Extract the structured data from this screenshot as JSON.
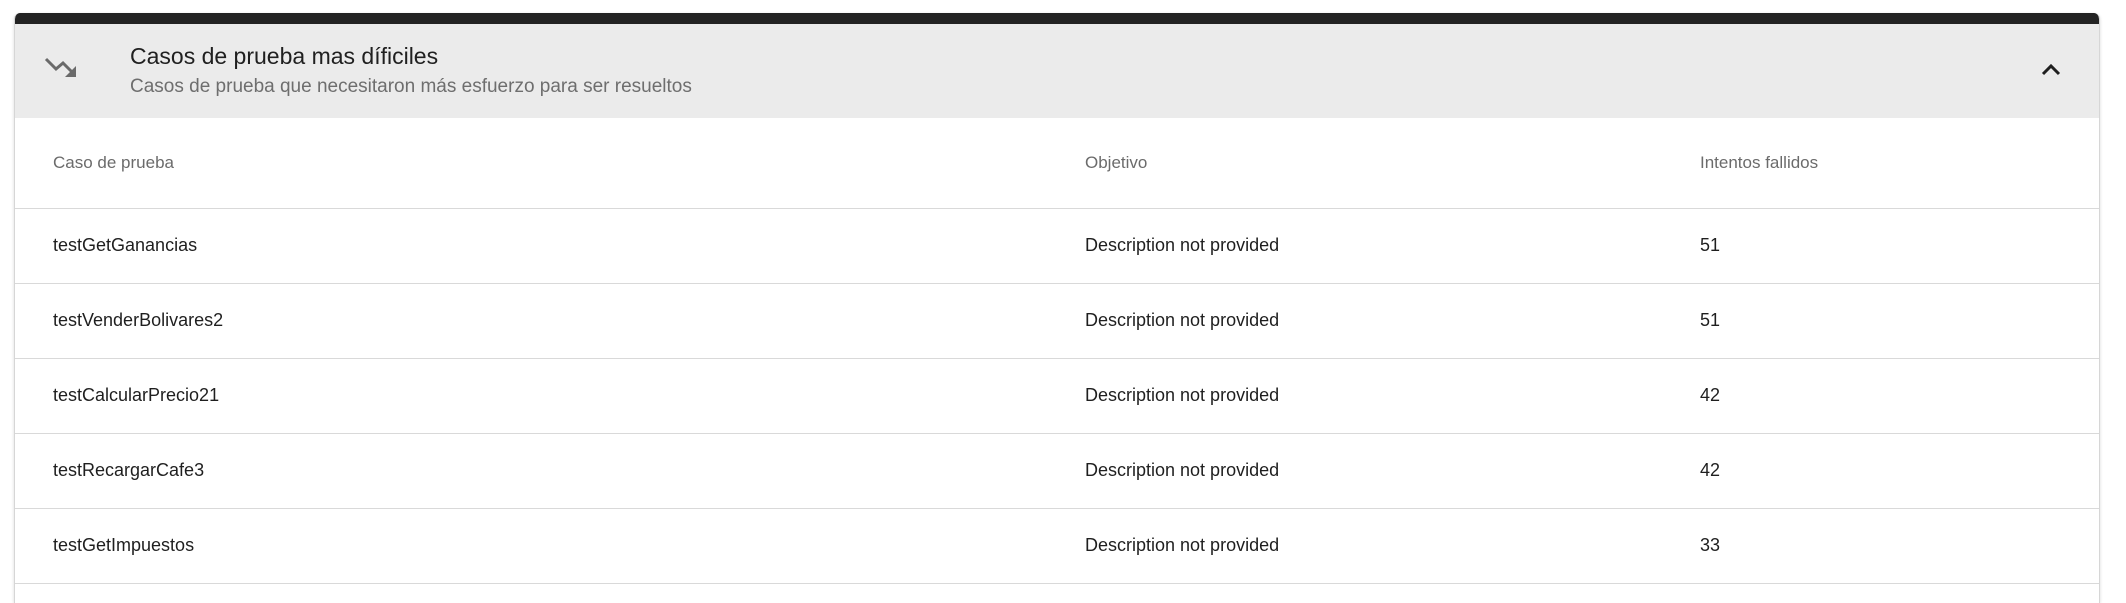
{
  "header": {
    "icon": "trending-down-icon",
    "title": "Casos de prueba mas díficiles",
    "subtitle": "Casos de prueba que necesitaron más esfuerzo para ser resueltos",
    "collapse_icon": "chevron-up-icon"
  },
  "table": {
    "columns": [
      "Caso de prueba",
      "Objetivo",
      "Intentos fallidos"
    ],
    "rows": [
      {
        "name": "testGetGanancias",
        "objective": "Description not provided",
        "failed": "51"
      },
      {
        "name": "testVenderBolivares2",
        "objective": "Description not provided",
        "failed": "51"
      },
      {
        "name": "testCalcularPrecio21",
        "objective": "Description not provided",
        "failed": "42"
      },
      {
        "name": "testRecargarCafe3",
        "objective": "Description not provided",
        "failed": "42"
      },
      {
        "name": "testGetImpuestos",
        "objective": "Description not provided",
        "failed": "33"
      }
    ]
  },
  "colors": {
    "topbar": "#232323",
    "header_bg": "#ebebeb",
    "divider": "#d9d9d9"
  }
}
